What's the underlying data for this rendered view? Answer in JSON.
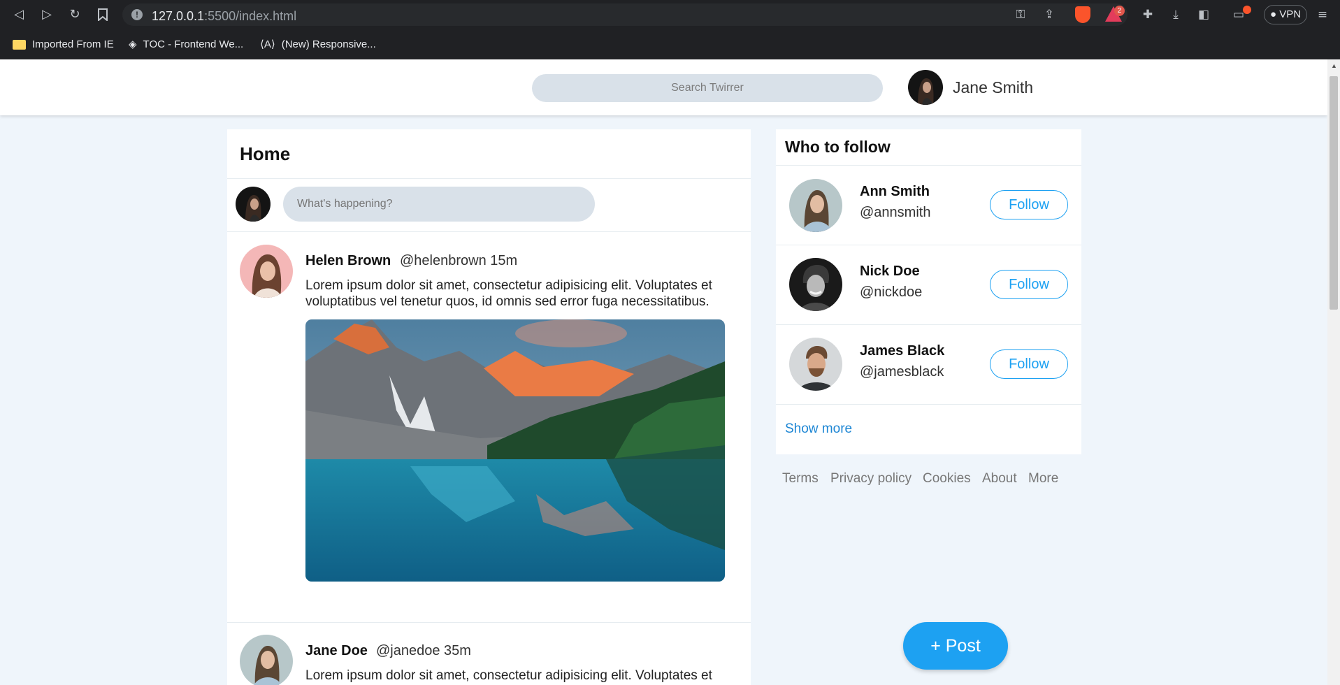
{
  "browser": {
    "url_host": "127.0.0.1",
    "url_path": ":5500/index.html",
    "rewards_badge": "2",
    "vpn_label": "VPN",
    "bookmarks": [
      {
        "label": "Imported From IE"
      },
      {
        "label": "TOC - Frontend We..."
      },
      {
        "label": "(New) Responsive..."
      }
    ]
  },
  "header": {
    "search_placeholder": "Search Twirrer",
    "user_name": "Jane Smith"
  },
  "feed": {
    "title": "Home",
    "compose_placeholder": "What's happening?",
    "tweets": [
      {
        "name": "Helen Brown",
        "handle": "@helenbrown",
        "time": "15m",
        "text": "Lorem ipsum dolor sit amet, consectetur adipisicing elit. Voluptates et voluptatibus vel tenetur quos, id omnis sed error fuga necessitatibus."
      },
      {
        "name": "Jane Doe",
        "handle": "@janedoe",
        "time": "35m",
        "text": "Lorem ipsum dolor sit amet, consectetur adipisicing elit. Voluptates et"
      }
    ]
  },
  "who_to_follow": {
    "title": "Who to follow",
    "users": [
      {
        "name": "Ann Smith",
        "handle": "@annsmith",
        "button": "Follow"
      },
      {
        "name": "Nick Doe",
        "handle": "@nickdoe",
        "button": "Follow"
      },
      {
        "name": "James Black",
        "handle": "@jamesblack",
        "button": "Follow"
      }
    ],
    "show_more": "Show more"
  },
  "footer_links": [
    {
      "label": "Terms"
    },
    {
      "label": "Privacy policy"
    },
    {
      "label": "Cookies"
    },
    {
      "label": "About"
    },
    {
      "label": "More"
    }
  ],
  "post_button": "+ Post",
  "colors": {
    "accent": "#1da1f2",
    "page_background": "#eff5fb",
    "input_background": "#d9e1e9"
  }
}
